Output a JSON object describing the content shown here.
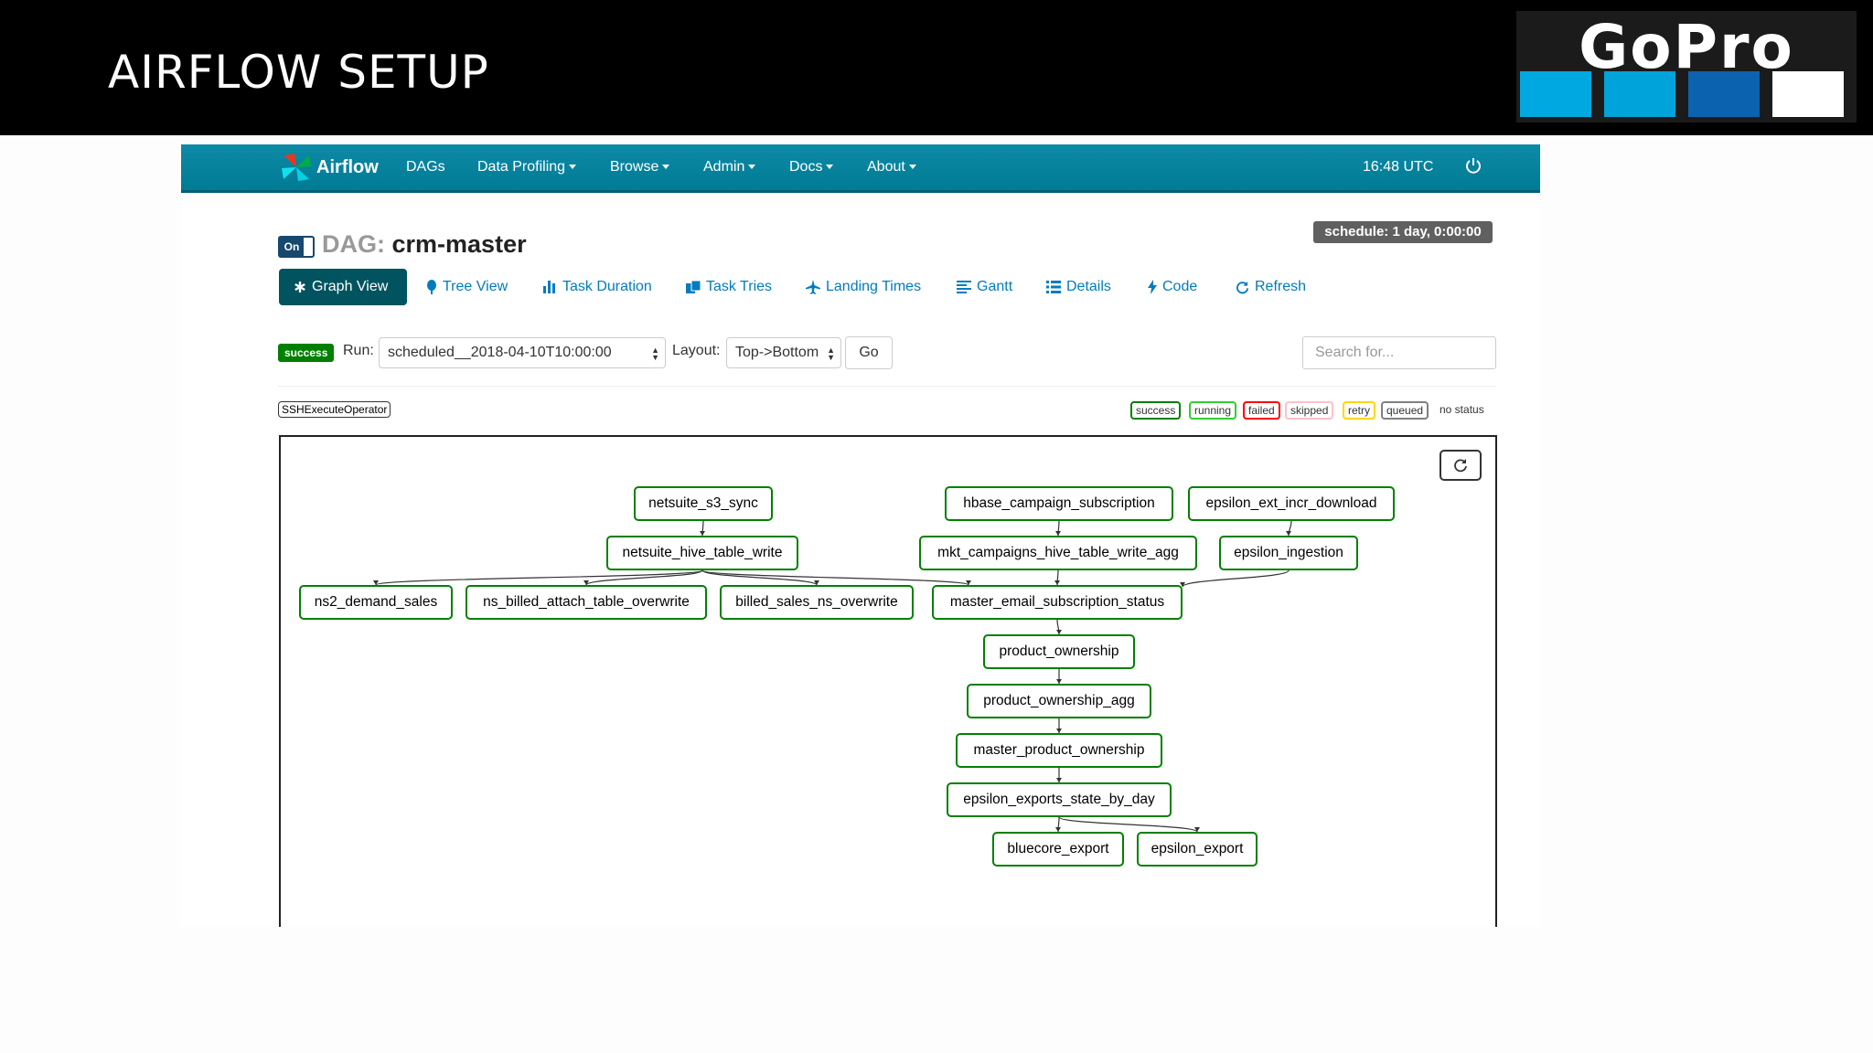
{
  "slide": {
    "title": "AIRFLOW SETUP",
    "logo_text": "GoPro"
  },
  "nav": {
    "brand": "Airflow",
    "items": [
      {
        "label": "DAGs",
        "dropdown": false
      },
      {
        "label": "Data Profiling",
        "dropdown": true
      },
      {
        "label": "Browse",
        "dropdown": true
      },
      {
        "label": "Admin",
        "dropdown": true
      },
      {
        "label": "Docs",
        "dropdown": true
      },
      {
        "label": "About",
        "dropdown": true
      }
    ],
    "time": "16:48 UTC",
    "power_icon": "power-icon"
  },
  "dag": {
    "toggle": "On",
    "label": "DAG:",
    "name": "crm-master",
    "schedule": "schedule: 1 day, 0:00:00"
  },
  "tabs": [
    {
      "label": "Graph View",
      "icon": "asterisk-icon",
      "active": true
    },
    {
      "label": "Tree View",
      "icon": "tree-icon",
      "active": false
    },
    {
      "label": "Task Duration",
      "icon": "bar-chart-icon",
      "active": false
    },
    {
      "label": "Task Tries",
      "icon": "duplicate-icon",
      "active": false
    },
    {
      "label": "Landing Times",
      "icon": "plane-icon",
      "active": false
    },
    {
      "label": "Gantt",
      "icon": "align-left-icon",
      "active": false
    },
    {
      "label": "Details",
      "icon": "list-icon",
      "active": false
    },
    {
      "label": "Code",
      "icon": "flash-icon",
      "active": false
    },
    {
      "label": "Refresh",
      "icon": "refresh-icon",
      "active": false
    }
  ],
  "controls": {
    "status": "success",
    "run_label": "Run:",
    "run_value": "scheduled__2018-04-10T10:00:00",
    "layout_label": "Layout:",
    "layout_value": "Top->Bottom",
    "go": "Go",
    "search_placeholder": "Search for..."
  },
  "operator": "SSHExecuteOperator",
  "legend": [
    {
      "label": "success",
      "color": "#008000"
    },
    {
      "label": "running",
      "color": "#32cd32"
    },
    {
      "label": "failed",
      "color": "#ff0000"
    },
    {
      "label": "skipped",
      "color": "#ffc0cb"
    },
    {
      "label": "retry",
      "color": "#ffd700"
    },
    {
      "label": "queued",
      "color": "#808080"
    },
    {
      "label": "no status",
      "color": "none"
    }
  ],
  "graph": {
    "node_status_color": "#008000",
    "nodes": [
      {
        "id": "netsuite_s3_sync"
      },
      {
        "id": "hbase_campaign_subscription"
      },
      {
        "id": "epsilon_ext_incr_download"
      },
      {
        "id": "netsuite_hive_table_write"
      },
      {
        "id": "mkt_campaigns_hive_table_write_agg"
      },
      {
        "id": "epsilon_ingestion"
      },
      {
        "id": "ns2_demand_sales"
      },
      {
        "id": "ns_billed_attach_table_overwrite"
      },
      {
        "id": "billed_sales_ns_overwrite"
      },
      {
        "id": "master_email_subscription_status"
      },
      {
        "id": "product_ownership"
      },
      {
        "id": "product_ownership_agg"
      },
      {
        "id": "master_product_ownership"
      },
      {
        "id": "epsilon_exports_state_by_day"
      },
      {
        "id": "bluecore_export"
      },
      {
        "id": "epsilon_export"
      }
    ],
    "edges": [
      [
        "netsuite_s3_sync",
        "netsuite_hive_table_write"
      ],
      [
        "netsuite_hive_table_write",
        "ns2_demand_sales"
      ],
      [
        "netsuite_hive_table_write",
        "ns_billed_attach_table_overwrite"
      ],
      [
        "netsuite_hive_table_write",
        "billed_sales_ns_overwrite"
      ],
      [
        "netsuite_hive_table_write",
        "master_email_subscription_status"
      ],
      [
        "hbase_campaign_subscription",
        "mkt_campaigns_hive_table_write_agg"
      ],
      [
        "mkt_campaigns_hive_table_write_agg",
        "master_email_subscription_status"
      ],
      [
        "epsilon_ext_incr_download",
        "epsilon_ingestion"
      ],
      [
        "epsilon_ingestion",
        "master_email_subscription_status"
      ],
      [
        "master_email_subscription_status",
        "product_ownership"
      ],
      [
        "product_ownership",
        "product_ownership_agg"
      ],
      [
        "product_ownership_agg",
        "master_product_ownership"
      ],
      [
        "master_product_ownership",
        "epsilon_exports_state_by_day"
      ],
      [
        "epsilon_exports_state_by_day",
        "bluecore_export"
      ],
      [
        "epsilon_exports_state_by_day",
        "epsilon_export"
      ]
    ]
  }
}
